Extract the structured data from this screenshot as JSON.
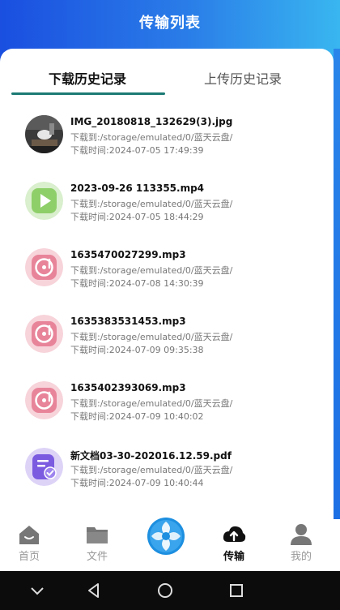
{
  "header": {
    "title": "传输列表"
  },
  "tabs": [
    {
      "label": "下载历史记录",
      "active": true
    },
    {
      "label": "上传历史记录",
      "active": false
    }
  ],
  "files": [
    {
      "name": "IMG_20180818_132629(3).jpg",
      "path": "下载到:/storage/emulated/0/蓝天云盘/",
      "time": "下载时间:2024-07-05 17:49:39",
      "icon": "image-thumbnail"
    },
    {
      "name": "2023-09-26 113355.mp4",
      "path": "下载到:/storage/emulated/0/蓝天云盘/",
      "time": "下载时间:2024-07-05 18:44:29",
      "icon": "video-icon"
    },
    {
      "name": "1635470027299.mp3",
      "path": "下载到:/storage/emulated/0/蓝天云盘/",
      "time": "下载时间:2024-07-08 14:30:39",
      "icon": "music-icon"
    },
    {
      "name": "1635383531453.mp3",
      "path": "下载到:/storage/emulated/0/蓝天云盘/",
      "time": "下载时间:2024-07-09 09:35:38",
      "icon": "music-icon"
    },
    {
      "name": "1635402393069.mp3",
      "path": "下载到:/storage/emulated/0/蓝天云盘/",
      "time": "下载时间:2024-07-09 10:40:02",
      "icon": "music-icon"
    },
    {
      "name": "新文档03-30-202016.12.59.pdf",
      "path": "下载到:/storage/emulated/0/蓝天云盘/",
      "time": "下载时间:2024-07-09 10:40:44",
      "icon": "document-icon"
    }
  ],
  "nav": [
    {
      "label": "首页",
      "icon": "home-icon",
      "active": false
    },
    {
      "label": "文件",
      "icon": "folder-icon",
      "active": false
    },
    {
      "label": "传输",
      "icon": "cloud-upload-icon",
      "active": true
    },
    {
      "label": "我的",
      "icon": "person-icon",
      "active": false
    }
  ],
  "colors": {
    "header_gradient_start": "#1a4fe0",
    "header_gradient_end": "#39b6f0",
    "tab_indicator": "#1c7a74",
    "video_green": "#8fcf6a",
    "music_pink": "#e8849a",
    "document_purple": "#7b5ce0"
  }
}
